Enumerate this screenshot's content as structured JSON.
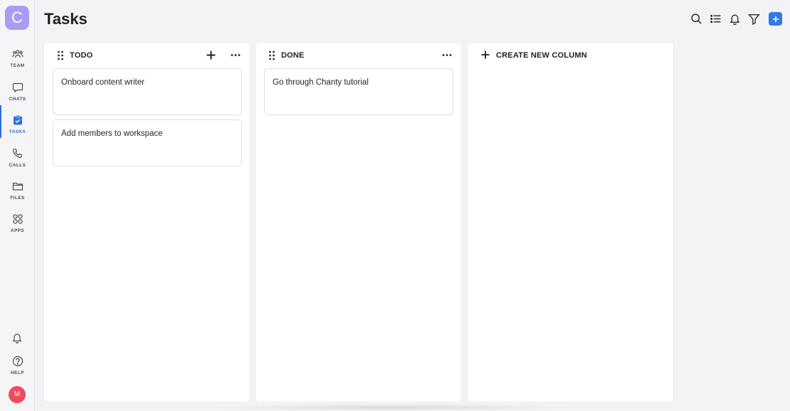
{
  "workspace": {
    "initial": "C",
    "color": "#a99cf4"
  },
  "nav": {
    "items": [
      {
        "label": "TEAM",
        "icon": "team-icon"
      },
      {
        "label": "CHATS",
        "icon": "chat-bubble-icon"
      },
      {
        "label": "TASKS",
        "icon": "tasks-icon",
        "active": true
      },
      {
        "label": "CALLS",
        "icon": "phone-icon"
      },
      {
        "label": "FILES",
        "icon": "folder-icon"
      },
      {
        "label": "APPS",
        "icon": "apps-grid-icon"
      }
    ],
    "help_label": "HELP",
    "avatar_initial": "M",
    "avatar_color": "#ef4b5c",
    "accent": "#2f6fdf"
  },
  "header": {
    "title": "Tasks",
    "actions": [
      "search-icon",
      "list-icon",
      "bell-icon",
      "filter-icon",
      "plus-icon"
    ],
    "add_color": "#2f7ae5"
  },
  "board": {
    "columns": [
      {
        "title": "TODO",
        "cards": [
          {
            "text": "Onboard content writer"
          },
          {
            "text": "Add members to workspace"
          }
        ]
      },
      {
        "title": "DONE",
        "cards": [
          {
            "text": "Go through Chanty tutorial"
          }
        ]
      }
    ],
    "create_column_label": "CREATE NEW COLUMN"
  }
}
